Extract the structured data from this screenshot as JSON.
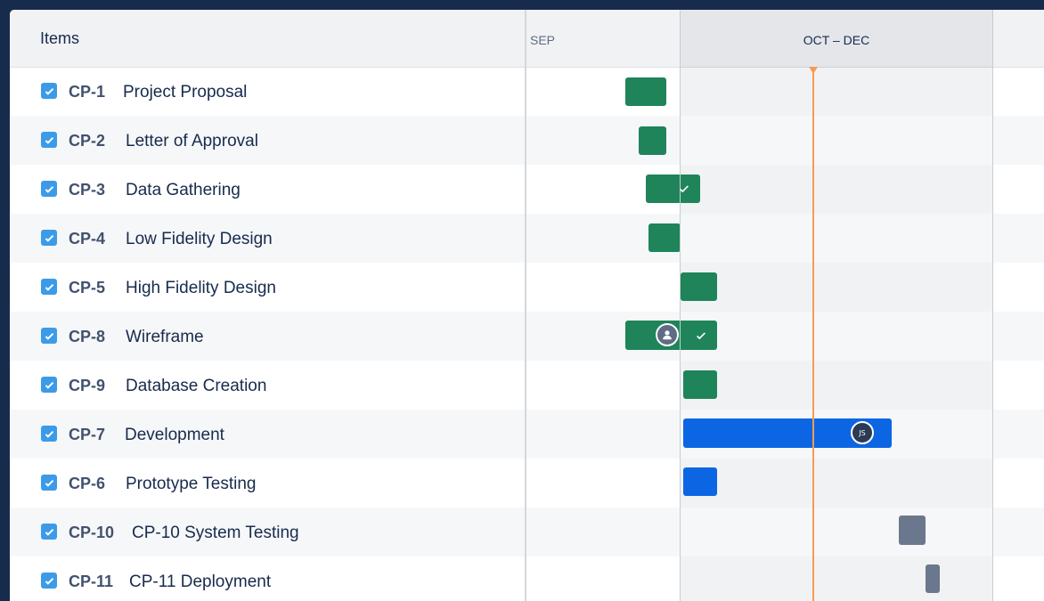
{
  "header": {
    "items_label": "Items",
    "months": [
      {
        "label": "SEP"
      },
      {
        "label": "OCT – DEC"
      }
    ]
  },
  "rows": [
    {
      "key": "CP-1",
      "summary": "Project Proposal",
      "done": true,
      "status": "done",
      "bar_color": "green"
    },
    {
      "key": "CP-2",
      "summary": "Letter of Approval",
      "done": true,
      "status": "done",
      "bar_color": "green"
    },
    {
      "key": "CP-3",
      "summary": "Data Gathering",
      "done": true,
      "status": "done",
      "bar_color": "green",
      "bar_check": true
    },
    {
      "key": "CP-4",
      "summary": "Low Fidelity Design",
      "done": true,
      "status": "done",
      "bar_color": "green"
    },
    {
      "key": "CP-5",
      "summary": "High Fidelity Design",
      "done": true,
      "status": "done",
      "bar_color": "green"
    },
    {
      "key": "CP-8",
      "summary": "Wireframe",
      "done": true,
      "status": "done",
      "bar_color": "green",
      "bar_check": true,
      "assignee": "person-icon"
    },
    {
      "key": "CP-9",
      "summary": "Database Creation",
      "done": true,
      "status": "done",
      "bar_color": "green"
    },
    {
      "key": "CP-7",
      "summary": "Development",
      "done": true,
      "status": "in-progress",
      "bar_color": "blue",
      "assignee_initials": "JS"
    },
    {
      "key": "CP-6",
      "summary": "Prototype Testing",
      "done": true,
      "status": "in-progress",
      "bar_color": "blue"
    },
    {
      "key": "CP-10",
      "summary": "CP-10 System Testing",
      "done": true,
      "status": "todo",
      "bar_color": "grey"
    },
    {
      "key": "CP-11",
      "summary": "CP-11 Deployment",
      "done": true,
      "status": "todo",
      "bar_color": "grey"
    }
  ],
  "colors": {
    "frame": "#172b4d",
    "done": "#1f845a",
    "in_progress": "#0c66e4",
    "todo": "#6b778c",
    "today_marker": "#f79b52",
    "checkbox": "#3b9be8"
  }
}
